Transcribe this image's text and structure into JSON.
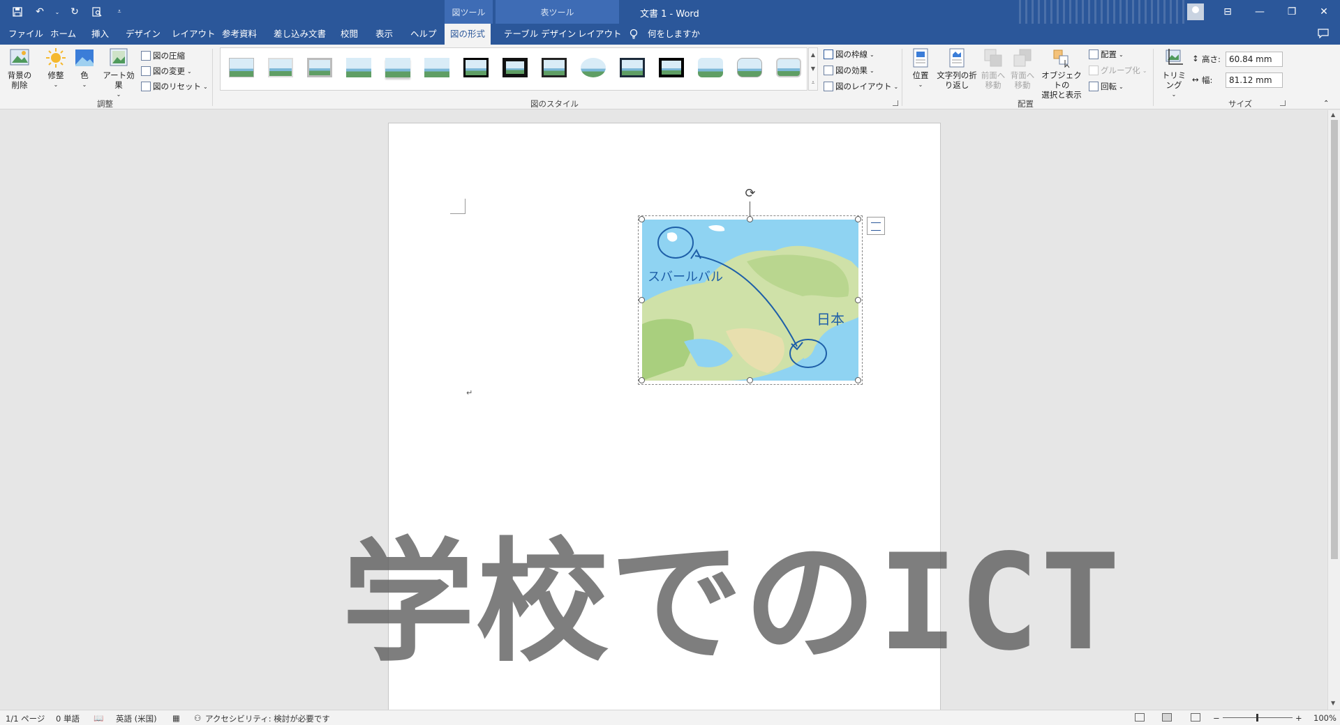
{
  "titlebar": {
    "doc_title": "文書 1  -  Word",
    "context_picture": "図ツール",
    "context_table": "表ツール",
    "qat": {
      "save": "save-icon",
      "undo": "undo-icon",
      "redo": "redo-icon",
      "preview": "print-preview-icon"
    }
  },
  "tabs": [
    {
      "label": "ファイル"
    },
    {
      "label": "ホーム"
    },
    {
      "label": "挿入"
    },
    {
      "label": "デザイン"
    },
    {
      "label": "レイアウト"
    },
    {
      "label": "参考資料"
    },
    {
      "label": "差し込み文書"
    },
    {
      "label": "校閲"
    },
    {
      "label": "表示"
    },
    {
      "label": "ヘルプ"
    },
    {
      "label": "図の形式",
      "active": true
    },
    {
      "label": "テーブル デザイン"
    },
    {
      "label": "レイアウト"
    }
  ],
  "tell_me": "何をしますか",
  "ribbon": {
    "adjust": {
      "label": "調整",
      "remove_bg": "背景の\n削除",
      "corrections": "修整",
      "color": "色",
      "artistic": "アート効果",
      "compress": "図の圧縮",
      "change": "図の変更",
      "reset": "図のリセット"
    },
    "styles": {
      "label": "図のスタイル",
      "border": "図の枠線",
      "effects": "図の効果",
      "layout": "図のレイアウト"
    },
    "arrange": {
      "label": "配置",
      "position": "位置",
      "wrap": "文字列の折\nり返し",
      "forward": "前面へ\n移動",
      "backward": "背面へ\n移動",
      "selection": "オブジェクトの\n選択と表示",
      "align": "配置",
      "group": "グループ化",
      "rotate": "回転"
    },
    "size": {
      "label": "サイズ",
      "crop": "トリミング",
      "height_label": "高さ:",
      "height_value": "60.84 mm",
      "width_label": "幅:",
      "width_value": "81.12 mm"
    }
  },
  "document": {
    "image_annotations": {
      "place1": "スバールバル",
      "place2": "日本"
    },
    "paragraph_mark": "↵"
  },
  "watermark": "学校でのICT",
  "statusbar": {
    "page": "1/1 ページ",
    "words": "0 単語",
    "language": "英語 (米国)",
    "accessibility": "アクセシビリティ: 検討が必要です",
    "zoom": "100%"
  },
  "colors": {
    "brand": "#2b579a",
    "ribbon_bg": "#f3f3f3",
    "canvas": "#e6e6e6"
  }
}
